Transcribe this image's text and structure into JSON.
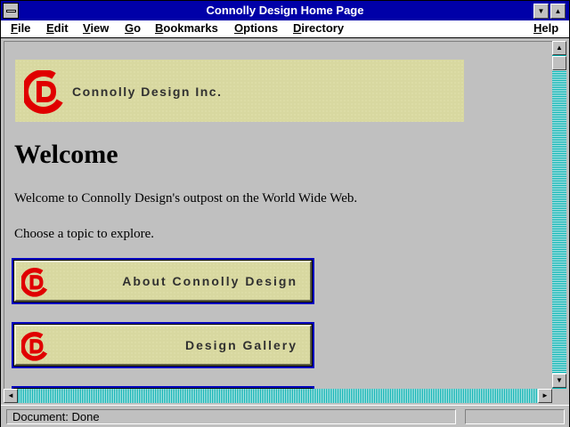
{
  "window": {
    "title": "Connolly Design Home Page"
  },
  "menubar": {
    "items": [
      {
        "label": "File",
        "accel": "F"
      },
      {
        "label": "Edit",
        "accel": "E"
      },
      {
        "label": "View",
        "accel": "V"
      },
      {
        "label": "Go",
        "accel": "G"
      },
      {
        "label": "Bookmarks",
        "accel": "B"
      },
      {
        "label": "Options",
        "accel": "O"
      },
      {
        "label": "Directory",
        "accel": "D"
      },
      {
        "label": "Help",
        "accel": "H"
      }
    ]
  },
  "page": {
    "banner_text": "Connolly Design Inc.",
    "heading": "Welcome",
    "intro": "Welcome to Connolly Design's outpost on the World Wide Web.",
    "prompt": "Choose a topic to explore.",
    "nav_buttons": [
      {
        "label": "About Connolly Design"
      },
      {
        "label": "Design Gallery"
      }
    ]
  },
  "status": {
    "text": "Document: Done"
  },
  "colors": {
    "title_bar": "#0000a8",
    "logo_red": "#e00000",
    "banner_bg": "#d8d8a0",
    "link_border": "#0000c0"
  },
  "icons": [
    "system-menu-icon",
    "minimize-icon",
    "maximize-icon",
    "scroll-up-icon",
    "scroll-down-icon",
    "scroll-left-icon",
    "scroll-right-icon",
    "cd-logo-icon"
  ]
}
